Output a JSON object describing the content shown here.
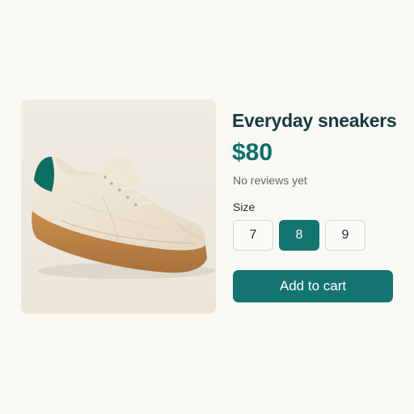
{
  "product": {
    "title": "Everyday sneakers",
    "price": "$80",
    "reviews_text": "No reviews yet"
  },
  "size": {
    "label": "Size",
    "options": [
      "7",
      "8",
      "9"
    ],
    "selected": "8"
  },
  "cart": {
    "button_label": "Add to cart"
  },
  "colors": {
    "accent": "#137470",
    "title": "#173a40",
    "background": "#faf8f3"
  },
  "image": {
    "subject": "sneaker-image"
  }
}
